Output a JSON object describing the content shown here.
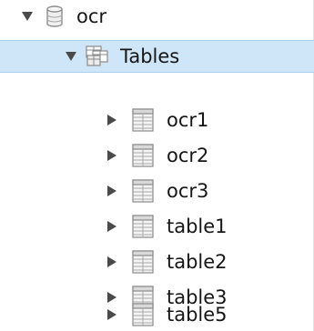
{
  "tree": {
    "database": {
      "label": "ocr",
      "expanded": true,
      "icon": "database-icon"
    },
    "tables_folder": {
      "label": "Tables",
      "expanded": true,
      "selected": true,
      "icon": "tables-folder-icon"
    },
    "tables": [
      {
        "label": "ocr1",
        "icon": "table-icon"
      },
      {
        "label": "ocr2",
        "icon": "table-icon"
      },
      {
        "label": "ocr3",
        "icon": "table-icon"
      },
      {
        "label": "table1",
        "icon": "table-icon"
      },
      {
        "label": "table2",
        "icon": "table-icon"
      },
      {
        "label": "table3",
        "icon": "table-icon"
      },
      {
        "label": "table5",
        "icon": "table-icon"
      }
    ]
  },
  "colors": {
    "selection_background": "#cfe6f8",
    "selection_border": "#a9d0ee",
    "toggle_arrow": "#4a4a4a"
  }
}
